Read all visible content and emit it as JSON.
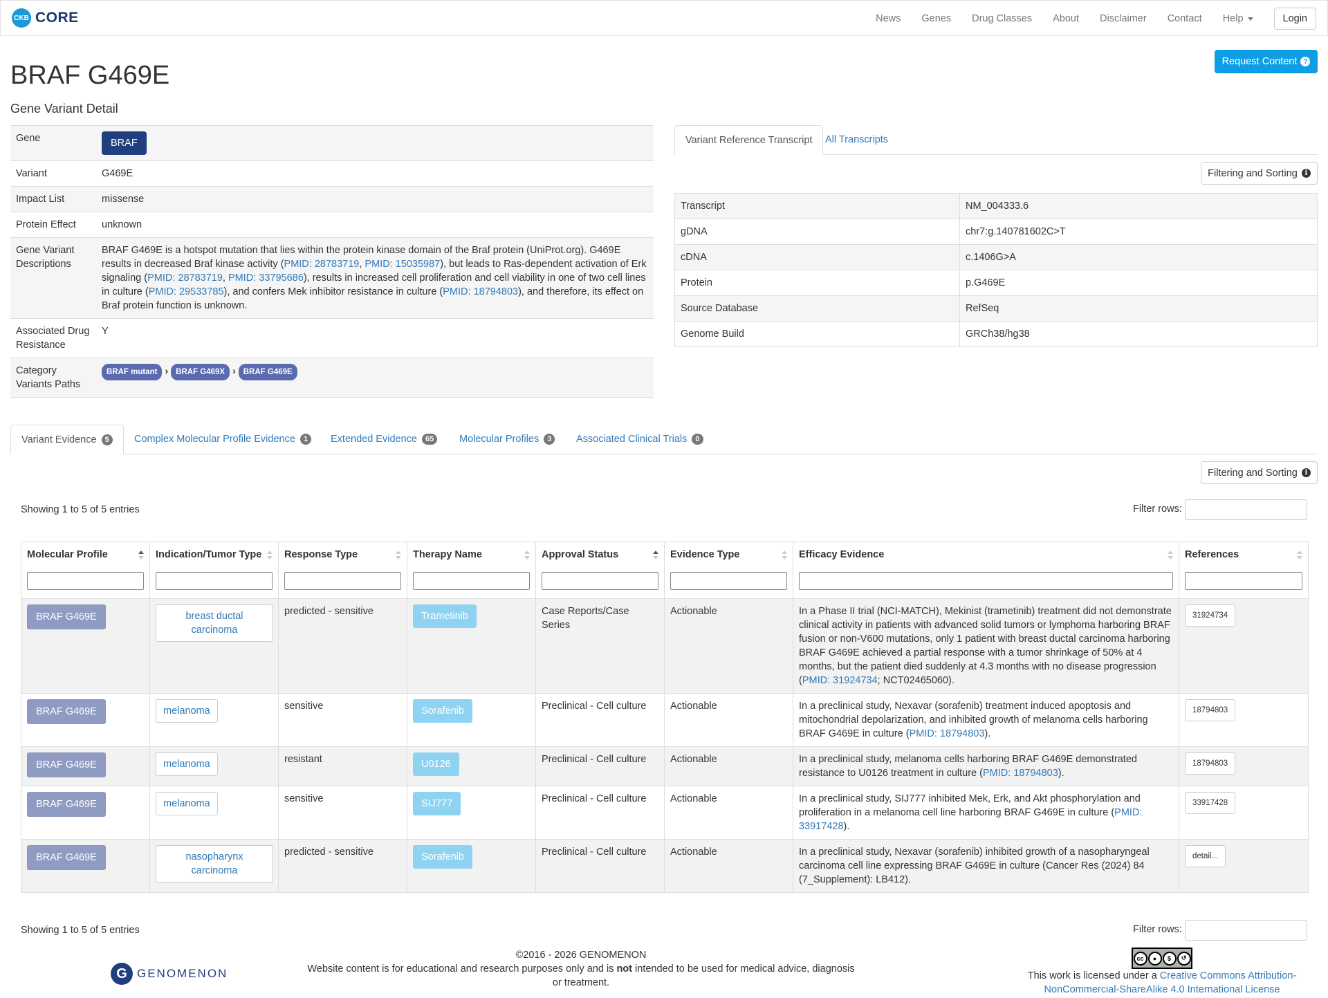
{
  "nav": {
    "logo_text": "CKB",
    "brand": "CORE",
    "links": [
      "News",
      "Genes",
      "Drug Classes",
      "About",
      "Disclaimer",
      "Contact"
    ],
    "help": "Help",
    "login": "Login"
  },
  "request_content": "Request Content",
  "title": "BRAF G469E",
  "subtitle": "Gene Variant Detail",
  "details": {
    "gene_label": "Gene",
    "gene": "BRAF",
    "variant_label": "Variant",
    "variant": "G469E",
    "impact_label": "Impact List",
    "impact": "missense",
    "protein_effect_label": "Protein Effect",
    "protein_effect": "unknown",
    "desc_label": "Gene Variant Descriptions",
    "desc": {
      "t1": "BRAF G469E is a hotspot mutation that lies within the protein kinase domain of the Braf protein (UniProt.org). G469E results in decreased Braf kinase activity (",
      "l1": "PMID: 28783719",
      "s1": ", ",
      "l2": "PMID: 15035987",
      "t2": "), but leads to Ras-dependent activation of Erk signaling (",
      "l3": "PMID: 28783719",
      "s2": ", ",
      "l4": "PMID: 33795686",
      "t3": "), results in increased cell proliferation and cell viability in one of two cell lines in culture (",
      "l5": "PMID: 29533785",
      "t4": "), and confers Mek inhibitor resistance in culture (",
      "l6": "PMID: 18794803",
      "t5": "), and therefore, its effect on Braf protein function is unknown."
    },
    "assoc_label": "Associated Drug Resistance",
    "assoc": "Y",
    "category_label": "Category Variants Paths",
    "paths": [
      "BRAF mutant",
      "BRAF G469X",
      "BRAF G469E"
    ]
  },
  "right_tabs": [
    "Variant Reference Transcript",
    "All Transcripts"
  ],
  "filter_sort": "Filtering and Sorting",
  "transcript": [
    {
      "k": "Transcript",
      "v": "NM_004333.6"
    },
    {
      "k": "gDNA",
      "v": "chr7:g.140781602C>T"
    },
    {
      "k": "cDNA",
      "v": "c.1406G>A"
    },
    {
      "k": "Protein",
      "v": "p.G469E"
    },
    {
      "k": "Source Database",
      "v": "RefSeq"
    },
    {
      "k": "Genome Build",
      "v": "GRCh38/hg38"
    }
  ],
  "evidence_tabs": [
    {
      "label": "Variant Evidence",
      "count": "5"
    },
    {
      "label": "Complex Molecular Profile Evidence",
      "count": "1"
    },
    {
      "label": "Extended Evidence",
      "count": "65"
    },
    {
      "label": "Molecular Profiles",
      "count": "3"
    },
    {
      "label": "Associated Clinical Trials",
      "count": "0"
    }
  ],
  "showing": "Showing 1 to 5 of 5 entries",
  "filter_rows": "Filter rows:",
  "columns": [
    "Molecular Profile",
    "Indication/Tumor Type",
    "Response Type",
    "Therapy Name",
    "Approval Status",
    "Evidence Type",
    "Efficacy Evidence",
    "References"
  ],
  "rows": [
    {
      "profile": "BRAF G469E",
      "tumor": "breast ductal carcinoma",
      "response": "predicted - sensitive",
      "therapy": "Trametinib",
      "approval": "Case Reports/Case Series",
      "evidence_type": "Actionable",
      "ev_text": "In a Phase II trial (NCI-MATCH), Mekinist (trametinib) treatment did not demonstrate clinical activity in patients with advanced solid tumors or lymphoma harboring BRAF fusion or non-V600 mutations, only 1 patient with breast ductal carcinoma harboring BRAF G469E achieved a partial response with a tumor shrinkage of 50% at 4 months, but the patient died suddenly at 4.3 months with no disease progression (",
      "ev_link": "PMID: 31924734",
      "ev_after": "; NCT02465060).",
      "ref": "31924734"
    },
    {
      "profile": "BRAF G469E",
      "tumor": "melanoma",
      "response": "sensitive",
      "therapy": "Sorafenib",
      "approval": "Preclinical - Cell culture",
      "evidence_type": "Actionable",
      "ev_text": "In a preclinical study, Nexavar (sorafenib) treatment induced apoptosis and mitochondrial depolarization, and inhibited growth of melanoma cells harboring BRAF G469E in culture (",
      "ev_link": "PMID: 18794803",
      "ev_after": ").",
      "ref": "18794803"
    },
    {
      "profile": "BRAF G469E",
      "tumor": "melanoma",
      "response": "resistant",
      "therapy": "U0126",
      "approval": "Preclinical - Cell culture",
      "evidence_type": "Actionable",
      "ev_text": "In a preclinical study, melanoma cells harboring BRAF G469E demonstrated resistance to U0126 treatment in culture (",
      "ev_link": "PMID: 18794803",
      "ev_after": ").",
      "ref": "18794803"
    },
    {
      "profile": "BRAF G469E",
      "tumor": "melanoma",
      "response": "sensitive",
      "therapy": "SIJ777",
      "approval": "Preclinical - Cell culture",
      "evidence_type": "Actionable",
      "ev_text": "In a preclinical study, SIJ777 inhibited Mek, Erk, and Akt phosphorylation and proliferation in a melanoma cell line harboring BRAF G469E in culture (",
      "ev_link": "PMID: 33917428",
      "ev_after": ").",
      "ref": "33917428"
    },
    {
      "profile": "BRAF G469E",
      "tumor": "nasopharynx carcinoma",
      "response": "predicted - sensitive",
      "therapy": "Sorafenib",
      "approval": "Preclinical - Cell culture",
      "evidence_type": "Actionable",
      "ev_text": "In a preclinical study, Nexavar (sorafenib) inhibited growth of a nasopharyngeal carcinoma cell line expressing BRAF G469E in culture (Cancer Res (2024) 84 (7_Supplement): LB412).",
      "ev_link": "",
      "ev_after": "",
      "ref": "detail..."
    }
  ],
  "footer": {
    "brand": "GENOMENON",
    "copyright": "©2016 - 2026 GENOMENON",
    "disclaimer_before": "Website content is for educational and research purposes only and is ",
    "disclaimer_bold": "not",
    "disclaimer_after": " intended to be used for medical advice, diagnosis or treatment.",
    "license_before": "This work is licensed under a ",
    "license_link": "Creative Commons Attribution-NonCommercial-ShareAlike 4.0 International License",
    "cc_text": "cc"
  }
}
